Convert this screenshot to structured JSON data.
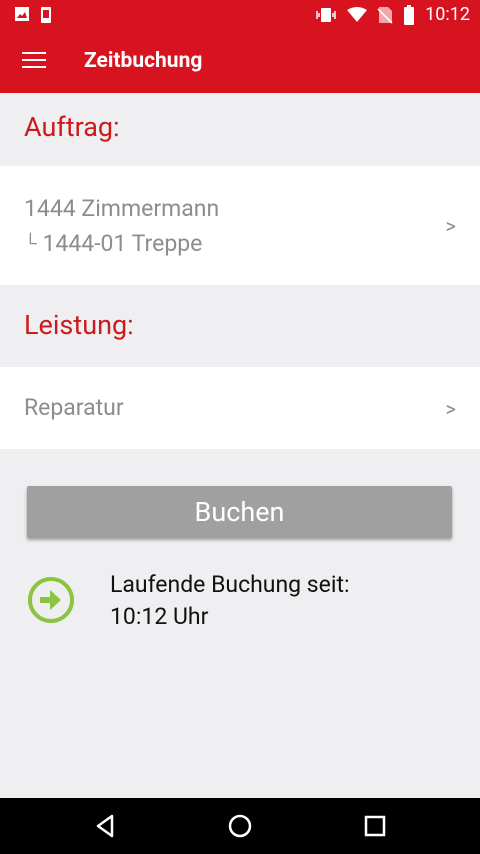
{
  "status_bar": {
    "time": "10:12"
  },
  "app_bar": {
    "title": "Zeitbuchung"
  },
  "auftrag": {
    "header": "Auftrag:",
    "line1": "1444 Zimmermann",
    "line2_prefix": "└",
    "line2": "1444-01 Treppe",
    "chevron": ">"
  },
  "leistung": {
    "header": "Leistung:",
    "value": "Reparatur",
    "chevron": ">"
  },
  "book_button": {
    "label": "Buchen"
  },
  "running": {
    "line1": "Laufende Buchung seit:",
    "line2": "10:12 Uhr",
    "icon_color": "#8bc53f"
  },
  "colors": {
    "accent": "#d7131f",
    "header_text": "#cf1a1d"
  }
}
